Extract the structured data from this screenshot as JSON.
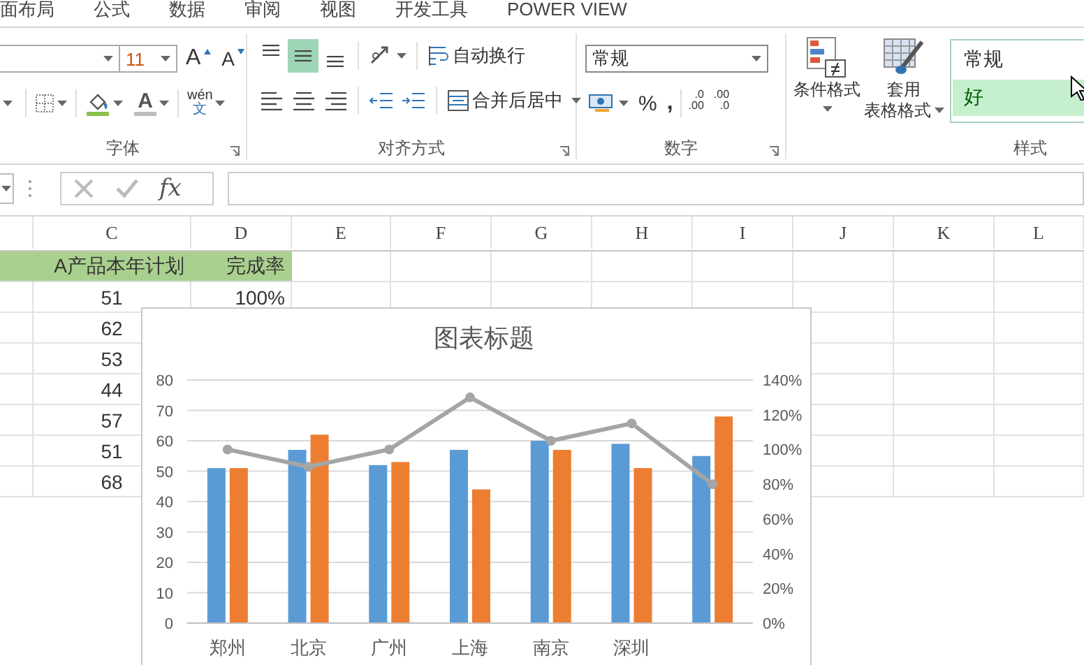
{
  "ribbon_tabs": [
    {
      "label": "面布局",
      "selected": false
    },
    {
      "label": "公式",
      "selected": false
    },
    {
      "label": "数据",
      "selected": false
    },
    {
      "label": "审阅",
      "selected": false
    },
    {
      "label": "视图",
      "selected": false
    },
    {
      "label": "开发工具",
      "selected": false
    },
    {
      "label": "POWER VIEW",
      "selected": false
    }
  ],
  "font_group": {
    "label": "字体",
    "font_size": "11",
    "grow_font": "A",
    "shrink_font": "A",
    "font_color": "A",
    "phonetic": {
      "pinyin": "wén",
      "character": "文"
    }
  },
  "alignment_group": {
    "label": "对齐方式",
    "align_buttons": [
      {
        "kind": "top",
        "selected": false
      },
      {
        "kind": "middle",
        "selected": true
      },
      {
        "kind": "bottom",
        "selected": false
      },
      {
        "kind": "left",
        "selected": false
      },
      {
        "kind": "center",
        "selected": false
      },
      {
        "kind": "right",
        "selected": false
      }
    ],
    "wrap_text": "自动换行",
    "merge_center": "合并后居中"
  },
  "number_group": {
    "label": "数字",
    "format": "常规",
    "percent": "%",
    "comma": ",",
    "increase_decimal": [
      ".0",
      ".00"
    ],
    "decrease_decimal": [
      ".00",
      ".0"
    ]
  },
  "styles_group": {
    "label": "样式",
    "conditional_format": "条件格式",
    "table_format": [
      "套用",
      "表格格式"
    ],
    "cell_styles": [
      {
        "label": "常规",
        "kind": "normal"
      },
      {
        "label": "好",
        "kind": "good"
      }
    ]
  },
  "formula_bar": {
    "function_label": "fx"
  },
  "sheet": {
    "columns": [
      "C",
      "D",
      "E",
      "F",
      "G",
      "H",
      "I",
      "J",
      "K",
      "L"
    ],
    "header": [
      "A产品本年计划",
      "完成率"
    ],
    "rows": [
      [
        "51",
        "100%"
      ],
      [
        "62"
      ],
      [
        "53"
      ],
      [
        "44"
      ],
      [
        "57"
      ],
      [
        "51"
      ],
      [
        "68"
      ]
    ]
  },
  "chart": {
    "chart_data": {
      "type": "bar",
      "title": "图表标题",
      "categories": [
        "郑州",
        "北京",
        "广州",
        "上海",
        "南京",
        "深圳",
        null
      ],
      "series": [
        {
          "color": "#5b9bd5",
          "values": [
            51,
            57,
            52,
            57,
            60,
            59,
            55
          ]
        },
        {
          "color": "#ed7d31",
          "values": [
            51,
            62,
            53,
            44,
            57,
            51,
            68
          ]
        },
        {
          "color": "#a5a5a5",
          "type": "line",
          "axis": "y2",
          "marker": true,
          "values": [
            1.0,
            0.9,
            1.0,
            1.3,
            1.05,
            1.15,
            0.8
          ]
        }
      ],
      "grid": true,
      "ylim": [
        0,
        80
      ],
      "yticks": [
        0,
        10,
        20,
        30,
        40,
        50,
        60,
        70,
        80
      ],
      "y2lim": [
        0,
        1.4
      ],
      "y2ticks": [
        {
          "value": 0,
          "label": "0%"
        },
        {
          "value": 0.2,
          "label": "20%"
        },
        {
          "value": 0.4,
          "label": "40%"
        },
        {
          "value": 0.6,
          "label": "60%"
        },
        {
          "value": 0.8,
          "label": "80%"
        },
        {
          "value": 1.0,
          "label": "100%"
        },
        {
          "value": 1.2,
          "label": "120%"
        },
        {
          "value": 1.4,
          "label": "140%"
        }
      ]
    }
  }
}
